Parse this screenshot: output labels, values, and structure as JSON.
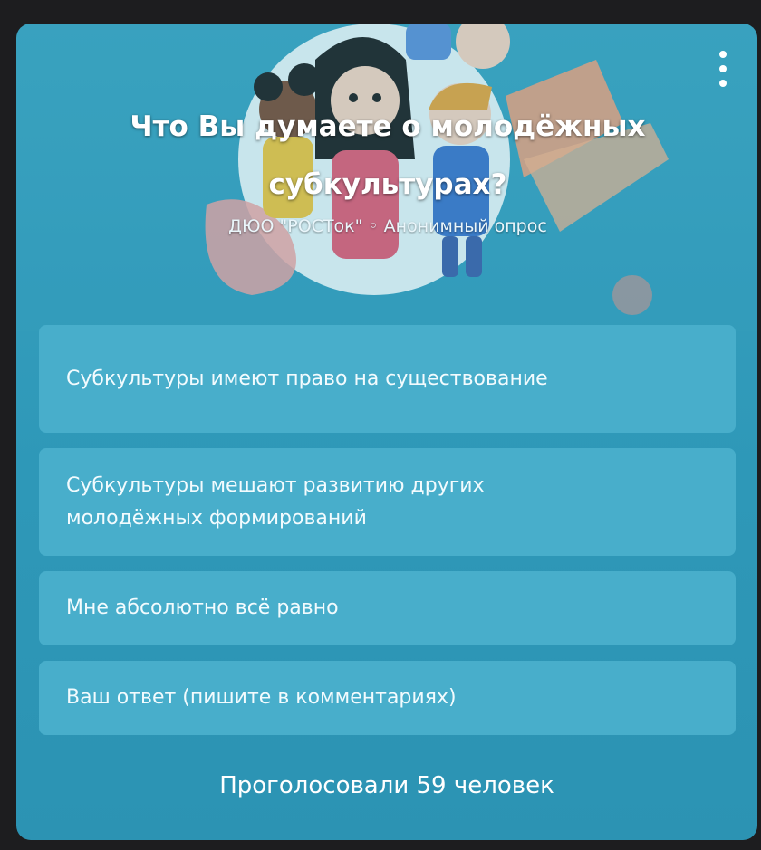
{
  "poll": {
    "title": "Что Вы думаете о молодёжных субкультурах?",
    "meta": "ДЮО \"РОСТок\" ◦ Анонимный опрос",
    "options": [
      "Субкультуры имеют право на существование",
      "Субкультуры мешают развитию других молодёжных формирований",
      "Мне абсолютно всё равно",
      "Ваш ответ (пишите в комментариях)"
    ],
    "votes_text": "Проголосовали 59 человек"
  },
  "colors": {
    "card_background": "#3aa2c0",
    "option_background": "#48aecb",
    "text": "#ffffff"
  },
  "icons": {
    "menu": "more-vertical-icon"
  }
}
